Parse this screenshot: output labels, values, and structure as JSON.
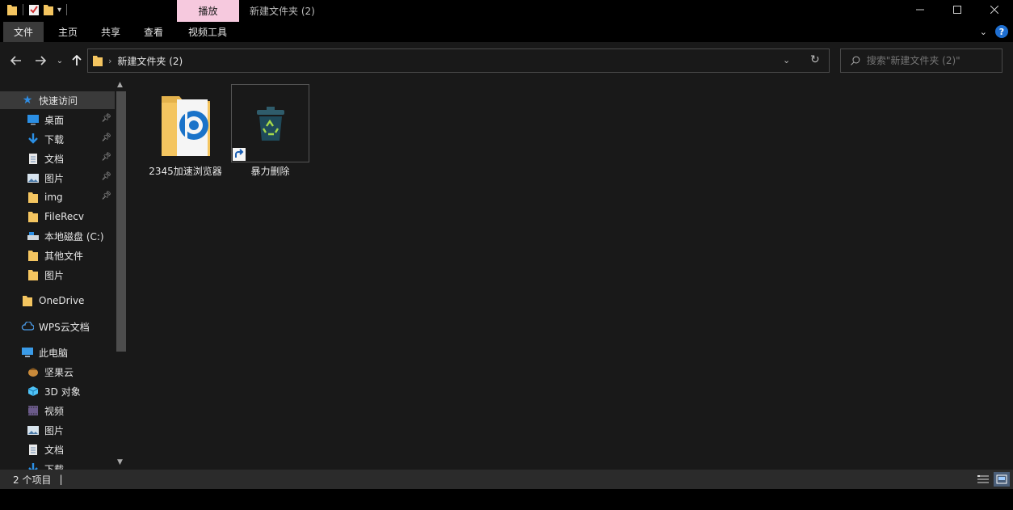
{
  "window": {
    "title": "新建文件夹 (2)",
    "context_tab": "播放"
  },
  "ribbon": {
    "tabs": [
      {
        "label": "文件",
        "active": true
      },
      {
        "label": "主页",
        "active": false
      },
      {
        "label": "共享",
        "active": false
      },
      {
        "label": "查看",
        "active": false
      },
      {
        "label": "视频工具",
        "active": false
      }
    ],
    "help_label": "?"
  },
  "address": {
    "path": "新建文件夹 (2)",
    "search_placeholder": "搜索\"新建文件夹 (2)\""
  },
  "nav": {
    "quick_access": "快速访问",
    "quick_items": [
      {
        "label": "桌面",
        "icon": "desktop-icon",
        "pinned": true
      },
      {
        "label": "下载",
        "icon": "download-icon",
        "pinned": true
      },
      {
        "label": "文档",
        "icon": "document-icon",
        "pinned": true
      },
      {
        "label": "图片",
        "icon": "pictures-icon",
        "pinned": true
      },
      {
        "label": "img",
        "icon": "folder-icon",
        "pinned": true
      },
      {
        "label": "FileRecv",
        "icon": "folder-icon",
        "pinned": false
      },
      {
        "label": "本地磁盘 (C:)",
        "icon": "drive-icon",
        "pinned": false
      },
      {
        "label": "其他文件",
        "icon": "folder-icon",
        "pinned": false
      },
      {
        "label": "图片",
        "icon": "folder-icon",
        "pinned": false
      }
    ],
    "onedrive": "OneDrive",
    "wps": "WPS云文档",
    "this_pc": "此电脑",
    "pc_items": [
      {
        "label": "坚果云",
        "icon": "nutstore-icon"
      },
      {
        "label": "3D 对象",
        "icon": "3d-objects-icon"
      },
      {
        "label": "视频",
        "icon": "videos-icon"
      },
      {
        "label": "图片",
        "icon": "pictures-icon"
      },
      {
        "label": "文档",
        "icon": "document-icon"
      },
      {
        "label": "下载",
        "icon": "download-icon"
      }
    ]
  },
  "files": [
    {
      "name": "2345加速浏览器",
      "icon": "browser-folder-icon"
    },
    {
      "name": "暴力删除",
      "icon": "trash-shortcut-icon"
    }
  ],
  "status": {
    "count": "2 个项目"
  },
  "colors": {
    "folder": "#f4c560",
    "accent": "#1f6fd1",
    "context_tab_bg": "#f6c9de"
  }
}
